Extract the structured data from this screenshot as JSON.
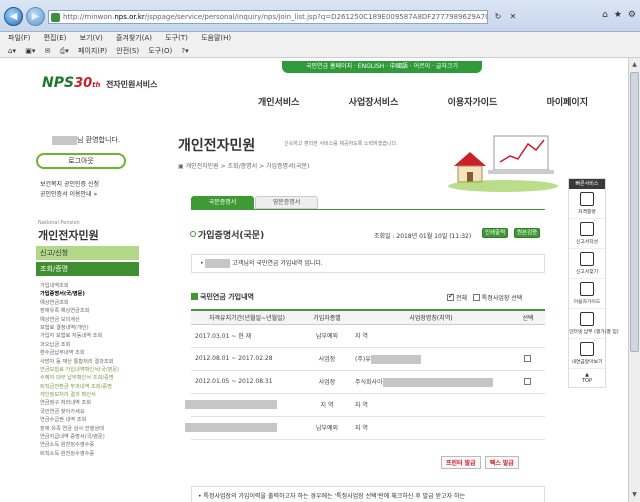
{
  "browser": {
    "url_prefix": "http://minwon.",
    "url_host": "nps.or.kr",
    "url_path": "/jsppage/service/personal/inquiry/nps/join_list.jsp?q=D261250C189E009587A8DF2777989629A700E45F5A188E#",
    "menus": [
      "파일(F)",
      "편집(E)",
      "보기(V)",
      "즐겨찾기(A)",
      "도구(T)",
      "도움말(H)"
    ],
    "toolbar": [
      "페이지(P)",
      "안전(S)",
      "도구(O)"
    ]
  },
  "header": {
    "util_text": "국민연금 홈페이지 · ENGLISH · 中國語 · 어르이 · 글자크기",
    "logo_nps": "NPS",
    "logo_30": "30",
    "logo_th": "th",
    "logo_service": "전자민원서비스",
    "nav": [
      "개인서비스",
      "사업장서비스",
      "이용자가이드",
      "마이페이지"
    ]
  },
  "sidebar": {
    "welcome_suffix": "님 환영합니다.",
    "logout_label": "로그아웃",
    "link1": "보건복지 공인인증 신청",
    "link2": "공인인증서 이용안내 »",
    "brand_en": "National Pension",
    "brand_title": "개인전자민원",
    "menu1": "신고/신청",
    "menu2": "조회/증명",
    "subitems": [
      "가입내역조회",
      "가입증명서(국/영문)",
      "예상연금조회",
      "장애유족 예상연금조회",
      "예상연금 모의계산",
      "보험료 결정내역(개인)",
      "가입자 보험료 자동내역 조회",
      "과오납금 조회",
      "환수금납부내역 조회",
      "사망자 등 재산 통합처리 결과조회",
      "연금보험료 가입내역확인서(국/영문)",
      "수혜자 대부 납부확인서 조회/증명",
      "퇴직금전환금 부과내역 조회/증명",
      "개인정보처리 결과 확인서",
      "연금청구 처리내역 조회",
      "국민연금 찾아가세요",
      "연금수급권 내역 조회",
      "장애 유족 연금 심사 진행상태",
      "연금지급내역 증명서(국/영문)",
      "연금소득 원천징수영수증",
      "퇴직소득 원천징수영수증"
    ],
    "active_index": 1
  },
  "main": {
    "title": "개인전자민원",
    "subtitle": "신속하고 편리한 서비스를 제공하도록 노력하겠습니다.",
    "breadcrumb": "▣ 개인전자민원 > 조회/증명서 > 가입증명서(국문)",
    "tab_kr": "국문증명서",
    "tab_en": "영문증명서",
    "section_title": "가입증명서(국문)",
    "lookup_time": "조회일 : 2018년 01월 10일 (11:32)",
    "btn_explain": "인쇄출력",
    "btn_verify": "원본검증",
    "notice_suffix": " 고객님의 국민연금 가입내역 입니다.",
    "table_title": "국민연금 가입내역",
    "check_all": "전체",
    "check_specific": "특정사업장 선택",
    "columns": [
      "자격유지기간(년월일~년월일)",
      "가입자종별",
      "사업장명칭(지역)",
      "선택"
    ],
    "rows": [
      {
        "period": "2017.03.01 ~ 현 재",
        "type": "납부예외",
        "name": "지 역",
        "blur_period": false,
        "blur_name": 0,
        "check": false
      },
      {
        "period": "2012.08.01 ~ 2017.02.28",
        "type": "사업장",
        "name": "(주)유",
        "blur_period": false,
        "blur_name": 50,
        "check": true
      },
      {
        "period": "2012.01.05 ~ 2012.08.31",
        "type": "사업장",
        "name": "주식회사아",
        "blur_period": false,
        "blur_name": 110,
        "check": true
      },
      {
        "period": "",
        "type": "지 역",
        "name": "지 역",
        "blur_period": true,
        "blur_name": 0,
        "check": false
      },
      {
        "period": "",
        "type": "납부예외",
        "name": "지 역",
        "blur_period": true,
        "blur_name": 0,
        "check": false
      }
    ],
    "print_btn": "프린터 발급",
    "fax_btn": "팩스 발급",
    "bottom_note": "• 특정사업장의 가입이력을 출력하고자 하는 경우에는 '특정사업장 선택'란에 체크하신 후 발급 받고자 하는"
  },
  "quickmenu": {
    "title": "빠른서비스",
    "items": [
      "자격증명",
      "신고서작성",
      "신고서찾기",
      "이용자가이드",
      "인터넷 납부 (평가/결 입)",
      "내연금알아보기"
    ],
    "top": "TOP"
  }
}
